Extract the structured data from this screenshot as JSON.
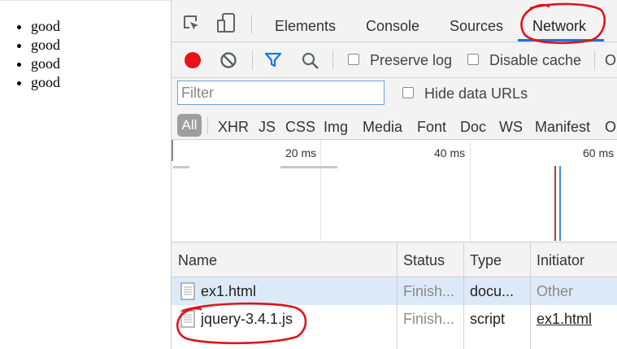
{
  "page": {
    "list_items": [
      "good",
      "good",
      "good",
      "good"
    ]
  },
  "devtools": {
    "tabs": [
      {
        "label": "Elements"
      },
      {
        "label": "Console"
      },
      {
        "label": "Sources"
      },
      {
        "label": "Network"
      }
    ],
    "toolbar": {
      "preserve_log": "Preserve log",
      "disable_cache": "Disable cache",
      "overflow": "O"
    },
    "filter": {
      "placeholder": "Filter",
      "hide_data_urls": "Hide data URLs"
    },
    "types": {
      "all": "All",
      "items": [
        "XHR",
        "JS",
        "CSS",
        "Img",
        "Media",
        "Font",
        "Doc",
        "WS",
        "Manifest",
        "O"
      ]
    },
    "timeline": {
      "ticks": [
        "20 ms",
        "40 ms",
        "60 ms"
      ]
    },
    "table": {
      "columns": [
        "Name",
        "Status",
        "Type",
        "Initiator"
      ],
      "rows": [
        {
          "name": "ex1.html",
          "status": "Finish...",
          "type": "docu...",
          "initiator": "Other"
        },
        {
          "name": "jquery-3.4.1.js",
          "status": "Finish...",
          "type": "script",
          "initiator": "ex1.html"
        }
      ]
    },
    "colors": {
      "record": "#e8131a",
      "accent": "#1a73e8",
      "annotation": "#e0131a"
    }
  }
}
